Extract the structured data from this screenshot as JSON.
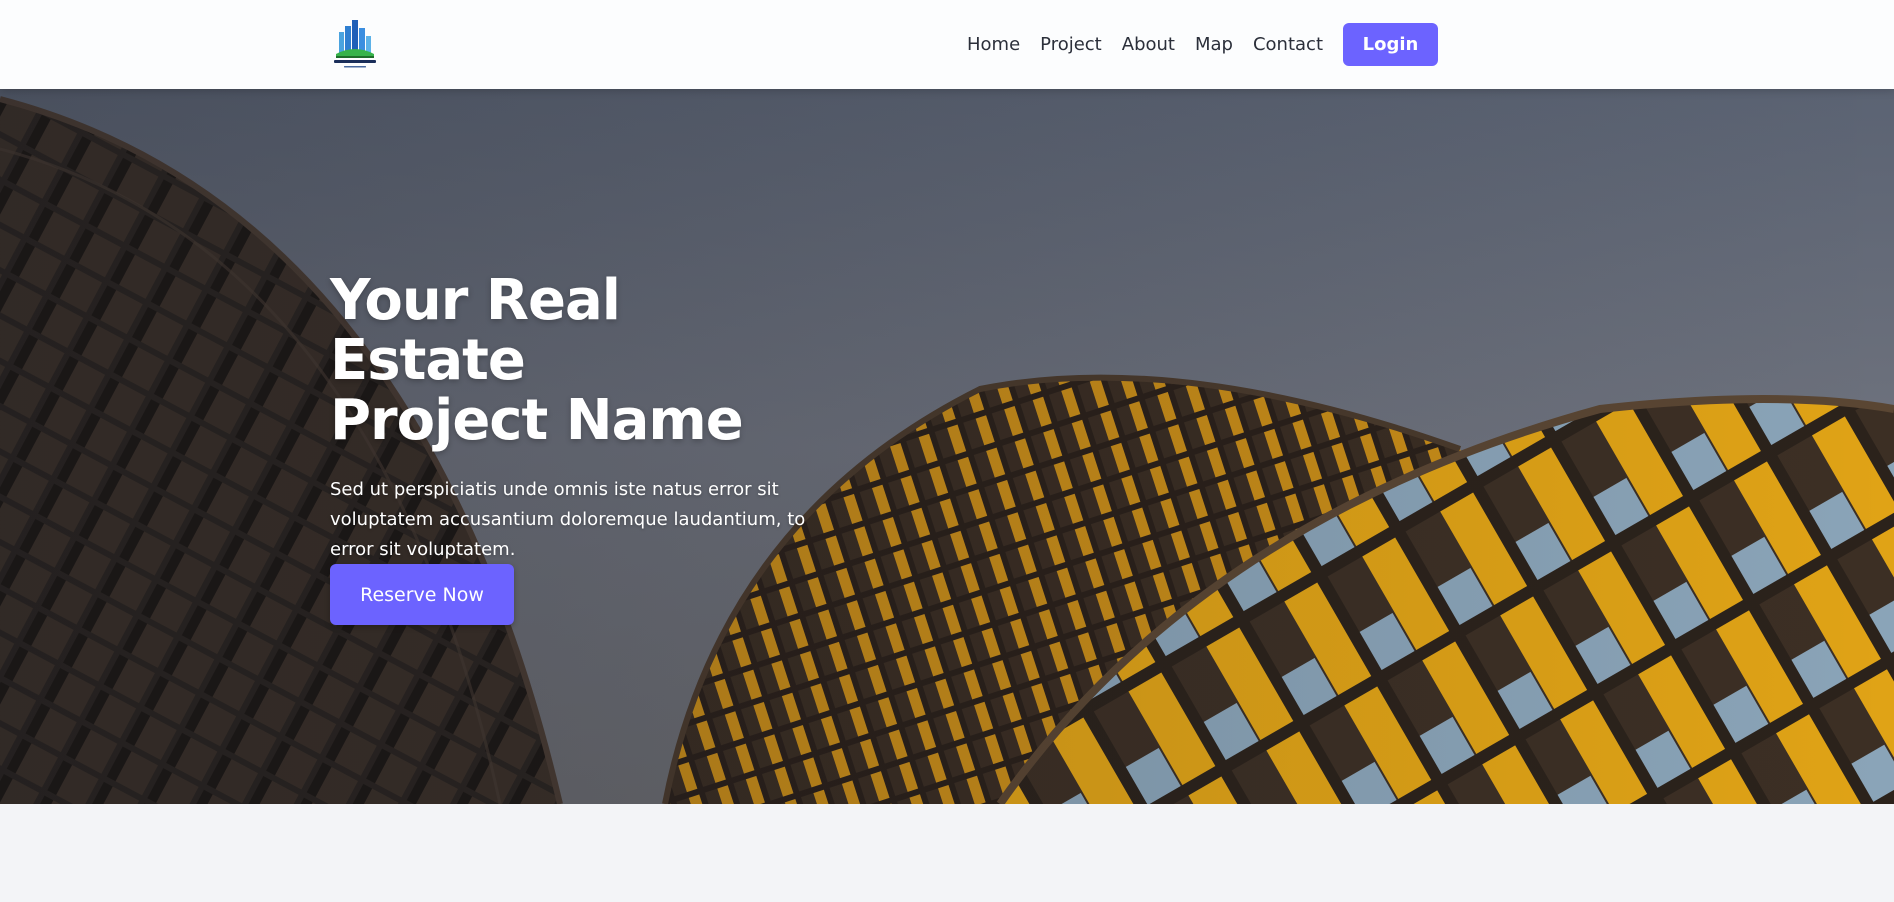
{
  "nav": {
    "logo_icon": "real-estate-building-logo",
    "links": [
      "Home",
      "Project",
      "About",
      "Map",
      "Contact"
    ],
    "login_label": "Login"
  },
  "hero": {
    "title_line1": "Your Real Estate",
    "title_line2": "Project Name",
    "description": "Sed ut perspiciatis unde omnis iste natus error sit voluptatem accusantium doloremque laudantium, to error sit voluptatem.",
    "cta_label": "Reserve Now"
  },
  "colors": {
    "accent": "#6c63ff",
    "nav_bg": "#fcfdfe",
    "page_bg": "#f3f4f7",
    "building_yellow": "#e0a316"
  }
}
